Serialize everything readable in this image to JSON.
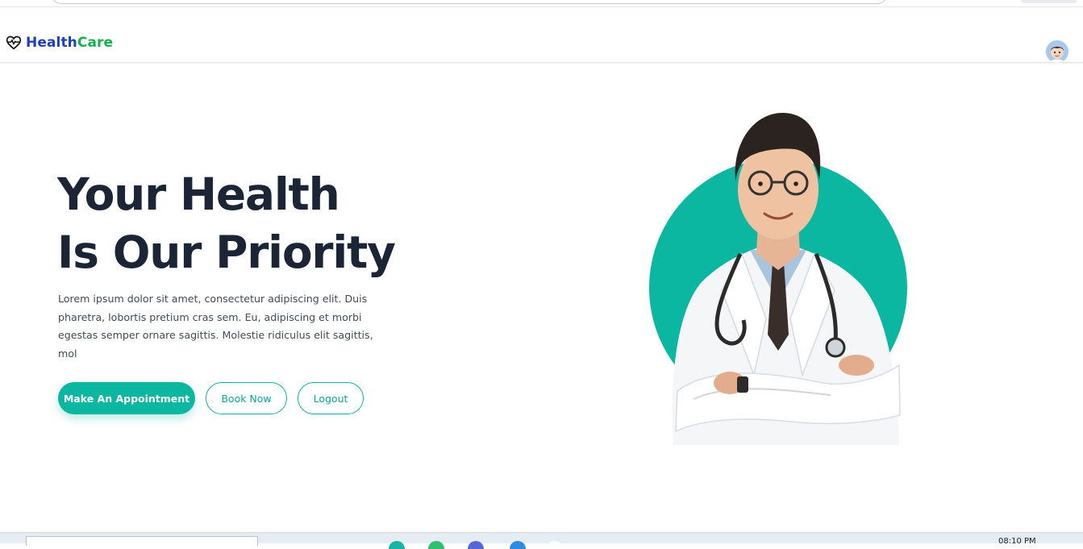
{
  "brand": {
    "name_part1": "Health",
    "name_part2": "Care",
    "icon": "heartbeat-icon",
    "color_part1": "#1d3fbf",
    "color_part2": "#10b24a"
  },
  "header": {
    "avatar_icon": "user-avatar-icon"
  },
  "hero": {
    "title_line1": "Your Health",
    "title_line2": "Is Our Priority",
    "description": "Lorem ipsum dolor sit amet, consectetur adipiscing elit. Duis pharetra, lobortis pretium cras sem. Eu, adipiscing et morbi egestas semper ornare sagittis. Molestie ridiculus elit sagittis, mol",
    "buttons": {
      "appointment": "Make An Appointment",
      "book": "Book Now",
      "logout": "Logout"
    },
    "accent_color": "#0bb7a1",
    "image_icon": "doctor-illustration"
  },
  "taskbar": {
    "clock": "08:10 PM"
  }
}
